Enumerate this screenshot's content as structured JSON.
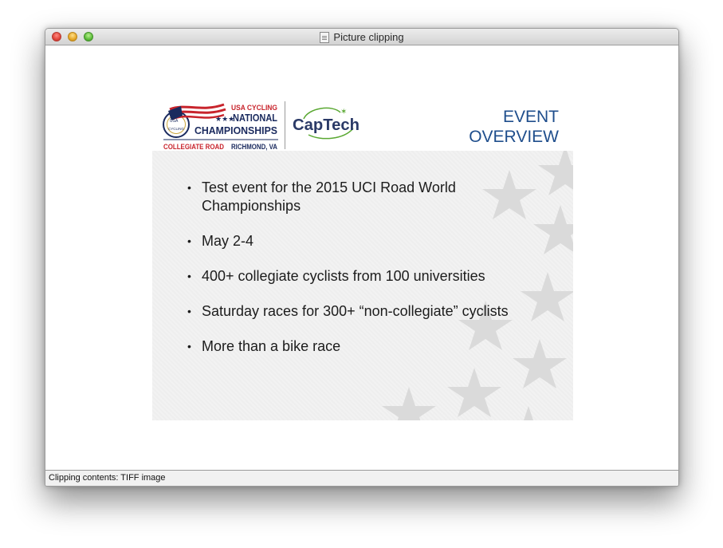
{
  "window": {
    "title": "Picture clipping"
  },
  "icons": {
    "close": "close-button",
    "minimize": "minimize-button",
    "zoom": "zoom-button",
    "document": "document-icon"
  },
  "slide": {
    "logo_usa": {
      "top_line": "USA CYCLING",
      "line_national": "NATIONAL",
      "line_championships": "CHAMPIONSHIPS",
      "bottom_left": "COLLEGIATE ROAD",
      "bottom_right": "RICHMOND, VA",
      "badge_text": "CYCLING",
      "badge_text_2": "USA"
    },
    "logo_captech": {
      "text": "CapTech"
    },
    "title_line1": "EVENT",
    "title_line2": "OVERVIEW",
    "bullets": [
      "Test event for the 2015 UCI Road World Championships",
      "May 2-4",
      "400+ collegiate cyclists from 100 universities",
      "Saturday races for 300+ “non-collegiate” cyclists",
      "More than a bike race"
    ],
    "bullet_char": "•"
  },
  "status": {
    "text": "Clipping contents: TIFF image"
  },
  "colors": {
    "title_blue": "#1f4e8c",
    "logo_red": "#c8242c",
    "logo_navy": "#1a2a5e",
    "captech_navy": "#2b3a67",
    "captech_green": "#5aa832"
  }
}
